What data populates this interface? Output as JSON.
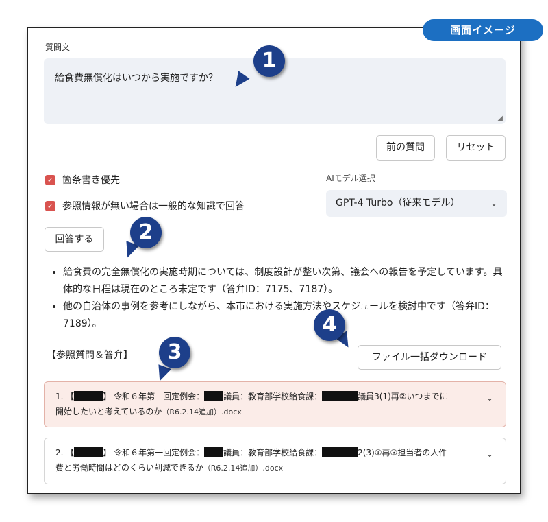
{
  "badge": "画面イメージ",
  "question": {
    "label": "質問文",
    "value": "給食費無償化はいつから実施ですか？"
  },
  "buttons": {
    "previous": "前の質問",
    "reset": "リセット",
    "answer": "回答する",
    "download": "ファイル一括ダウンロード"
  },
  "options": {
    "bullet_priority": "箇条書き優先",
    "general_knowledge": "参照情報が無い場合は一般的な知識で回答"
  },
  "model": {
    "label": "AIモデル選択",
    "selected": "GPT-4 Turbo（従来モデル）"
  },
  "answer_bullets": [
    "給食費の完全無償化の実施時期については、制度設計が整い次第、議会への報告を予定しています。具体的な日程は現在のところ未定です（答弁ID：7175、7187）。",
    "他の自治体の事例を参考にしながら、本市における実施方法やスケジュールを検討中です（答弁ID：7189）。"
  ],
  "references": {
    "heading": "【参照質問＆答弁】",
    "items": [
      {
        "index": "1.",
        "part_a": "【",
        "part_b": "】 令和６年第一回定例会：",
        "part_c": "議員：教育部学校給食課：",
        "part_d": "議員3(1)再②いつまでに",
        "line2": "開始したいと考えているのか",
        "fname": "（R6.2.14追加）.docx"
      },
      {
        "index": "2.",
        "part_a": "【",
        "part_b": "】 令和６年第一回定例会：",
        "part_c": "議員：教育部学校給食課：",
        "part_d": "2(3)①再③担当者の人件",
        "line2": "費と労働時間はどのくらい削減できるか",
        "fname": "（R6.2.14追加）.docx"
      }
    ]
  },
  "markers": [
    "1",
    "2",
    "3",
    "4"
  ],
  "colors": {
    "badge": "#1c6fc2",
    "marker": "#1d3f8a",
    "checkbox": "#d9534f",
    "highlight_card": "#fbece8"
  }
}
